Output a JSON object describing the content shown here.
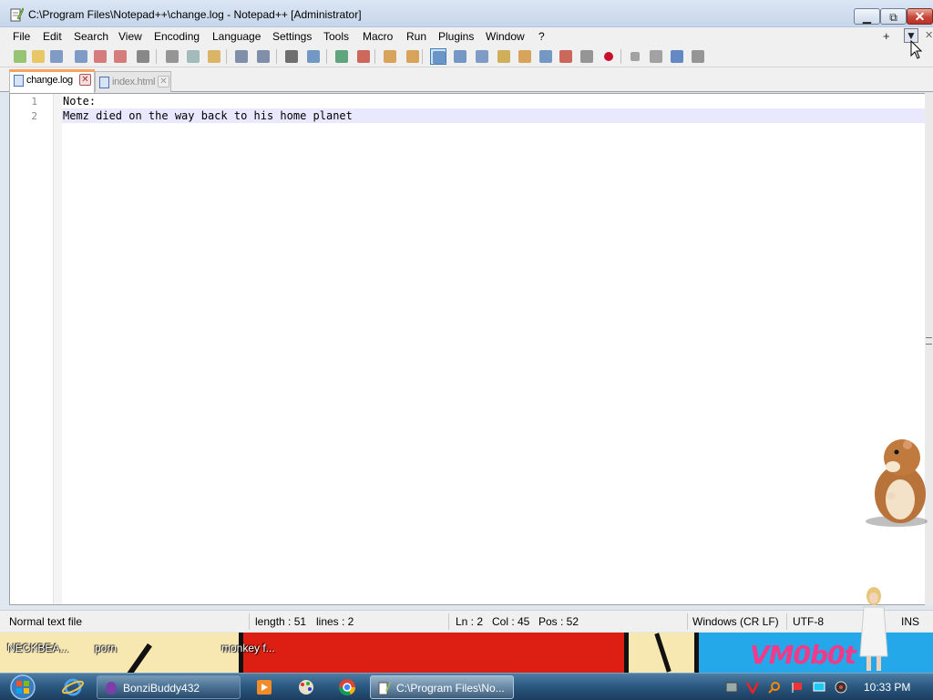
{
  "window": {
    "title": "C:\\Program Files\\Notepad++\\change.log - Notepad++ [Administrator]",
    "min_glyph": "▭",
    "max_glyph": "⧉",
    "close_glyph": "✕"
  },
  "menu": {
    "items": [
      "File",
      "Edit",
      "Search",
      "View",
      "Encoding",
      "Language",
      "Settings",
      "Tools",
      "Macro",
      "Run",
      "Plugins",
      "Window",
      "?"
    ],
    "plus": "+",
    "dropdown": "▼",
    "close_doc": "✕"
  },
  "toolbar": {
    "icons": [
      "new-file",
      "open-file",
      "save",
      "save-all",
      "close",
      "close-all",
      "print",
      "cut",
      "copy",
      "paste",
      "undo",
      "redo",
      "find",
      "replace",
      "zoom-in",
      "zoom-out",
      "sync-vertical",
      "sync-horizontal",
      "word-wrap",
      "show-all-characters",
      "indent-guide",
      "user-defined-language",
      "document-map",
      "function-list",
      "folder-as-workspace",
      "monitoring",
      "record-macro",
      "stop-recording",
      "playback-macro",
      "run-macro-multiple",
      "save-macro"
    ]
  },
  "tabs": [
    {
      "label": "change.log",
      "active": true,
      "close": "✕"
    },
    {
      "label": "index.html",
      "active": false,
      "close": "✕"
    }
  ],
  "editor": {
    "lines": [
      {
        "number": "1",
        "text": "Note:"
      },
      {
        "number": "2",
        "text": "Memz died on the way back to his home planet"
      }
    ],
    "current_line": 2
  },
  "statusbar": {
    "file_type": "Normal text file",
    "length": "length : 51",
    "lines": "lines : 2",
    "ln": "Ln : 2",
    "col": "Col : 45",
    "pos": "Pos : 52",
    "eol": "Windows (CR LF)",
    "encoding": "UTF-8",
    "mode": "INS"
  },
  "desktop": {
    "icons": [
      {
        "label": "NECKBEA..."
      },
      {
        "label": "porn"
      },
      {
        "label": "monkey f..."
      }
    ],
    "wallpaper_text": "VM0b0t"
  },
  "taskbar": {
    "buttons": [
      {
        "label": "BonziBuddy432",
        "active": false
      },
      {
        "label": "C:\\Program Files\\No...",
        "active": true
      }
    ],
    "clock": "10:33 PM"
  },
  "colors": {
    "current_line": "#e8e8ff",
    "active_tab_accent": "#f9a35c",
    "close_button": "#c7463a",
    "taskbar": "#2c5a82"
  }
}
